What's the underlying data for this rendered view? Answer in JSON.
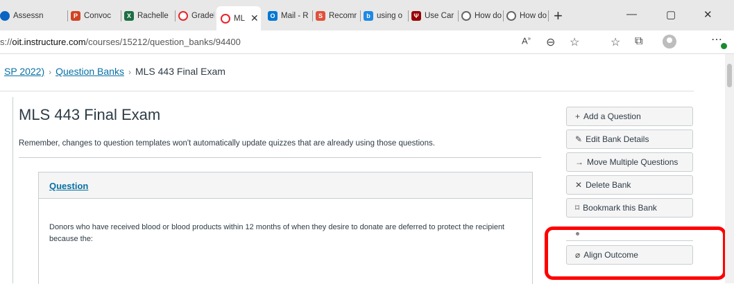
{
  "browser": {
    "tabs": [
      {
        "label": "Assessn",
        "icon": "cloud-icon",
        "color": "#0a66c2"
      },
      {
        "label": "Convoc",
        "icon": "powerpoint-icon",
        "color": "#d04423"
      },
      {
        "label": "Rachelle",
        "icon": "excel-icon",
        "color": "#1d6f42"
      },
      {
        "label": "Gradeb",
        "icon": "canvas-icon",
        "color": "#e72429"
      },
      {
        "label": "ML",
        "icon": "canvas-icon",
        "color": "#e72429",
        "active": true
      },
      {
        "label": "Mail - R",
        "icon": "outlook-icon",
        "color": "#0078d4"
      },
      {
        "label": "Recomr",
        "icon": "s-icon",
        "color": "#e0503a"
      },
      {
        "label": "using o",
        "icon": "bing-icon",
        "color": "#1e88e5"
      },
      {
        "label": "Use Car",
        "icon": "iu-icon",
        "color": "#990000"
      },
      {
        "label": "How do",
        "icon": "canvas-icon",
        "color": "#666666"
      },
      {
        "label": "How do",
        "icon": "canvas-icon",
        "color": "#666666"
      }
    ],
    "tab_close_glyph": "✕",
    "new_tab_glyph": "+",
    "window_controls": {
      "minimize": "—",
      "maximize": "▢",
      "close": "✕"
    },
    "url_prefix": "s://",
    "url_host": "oit.instructure.com",
    "url_path": "/courses/15212/question_banks/94400"
  },
  "breadcrumb": {
    "course": "SP 2022)",
    "question_banks": "Question Banks",
    "current": "MLS 443 Final Exam",
    "separator": "›"
  },
  "page": {
    "title": "MLS 443 Final Exam",
    "notice": "Remember, changes to question templates won't automatically update quizzes that are already using those questions."
  },
  "question": {
    "header": "Question",
    "text": "Donors who have received blood or blood products within 12 months of when they desire to donate are deferred to protect the recipient because the:"
  },
  "sidebar": {
    "add_question": "Add a Question",
    "edit_bank": "Edit Bank Details",
    "move_questions": "Move Multiple Questions",
    "delete_bank": "Delete Bank",
    "bookmark_bank": "Bookmark this Bank",
    "align_outcome": "Align Outcome"
  },
  "colors": {
    "link": "#0770a3",
    "highlight": "#ff0000"
  }
}
